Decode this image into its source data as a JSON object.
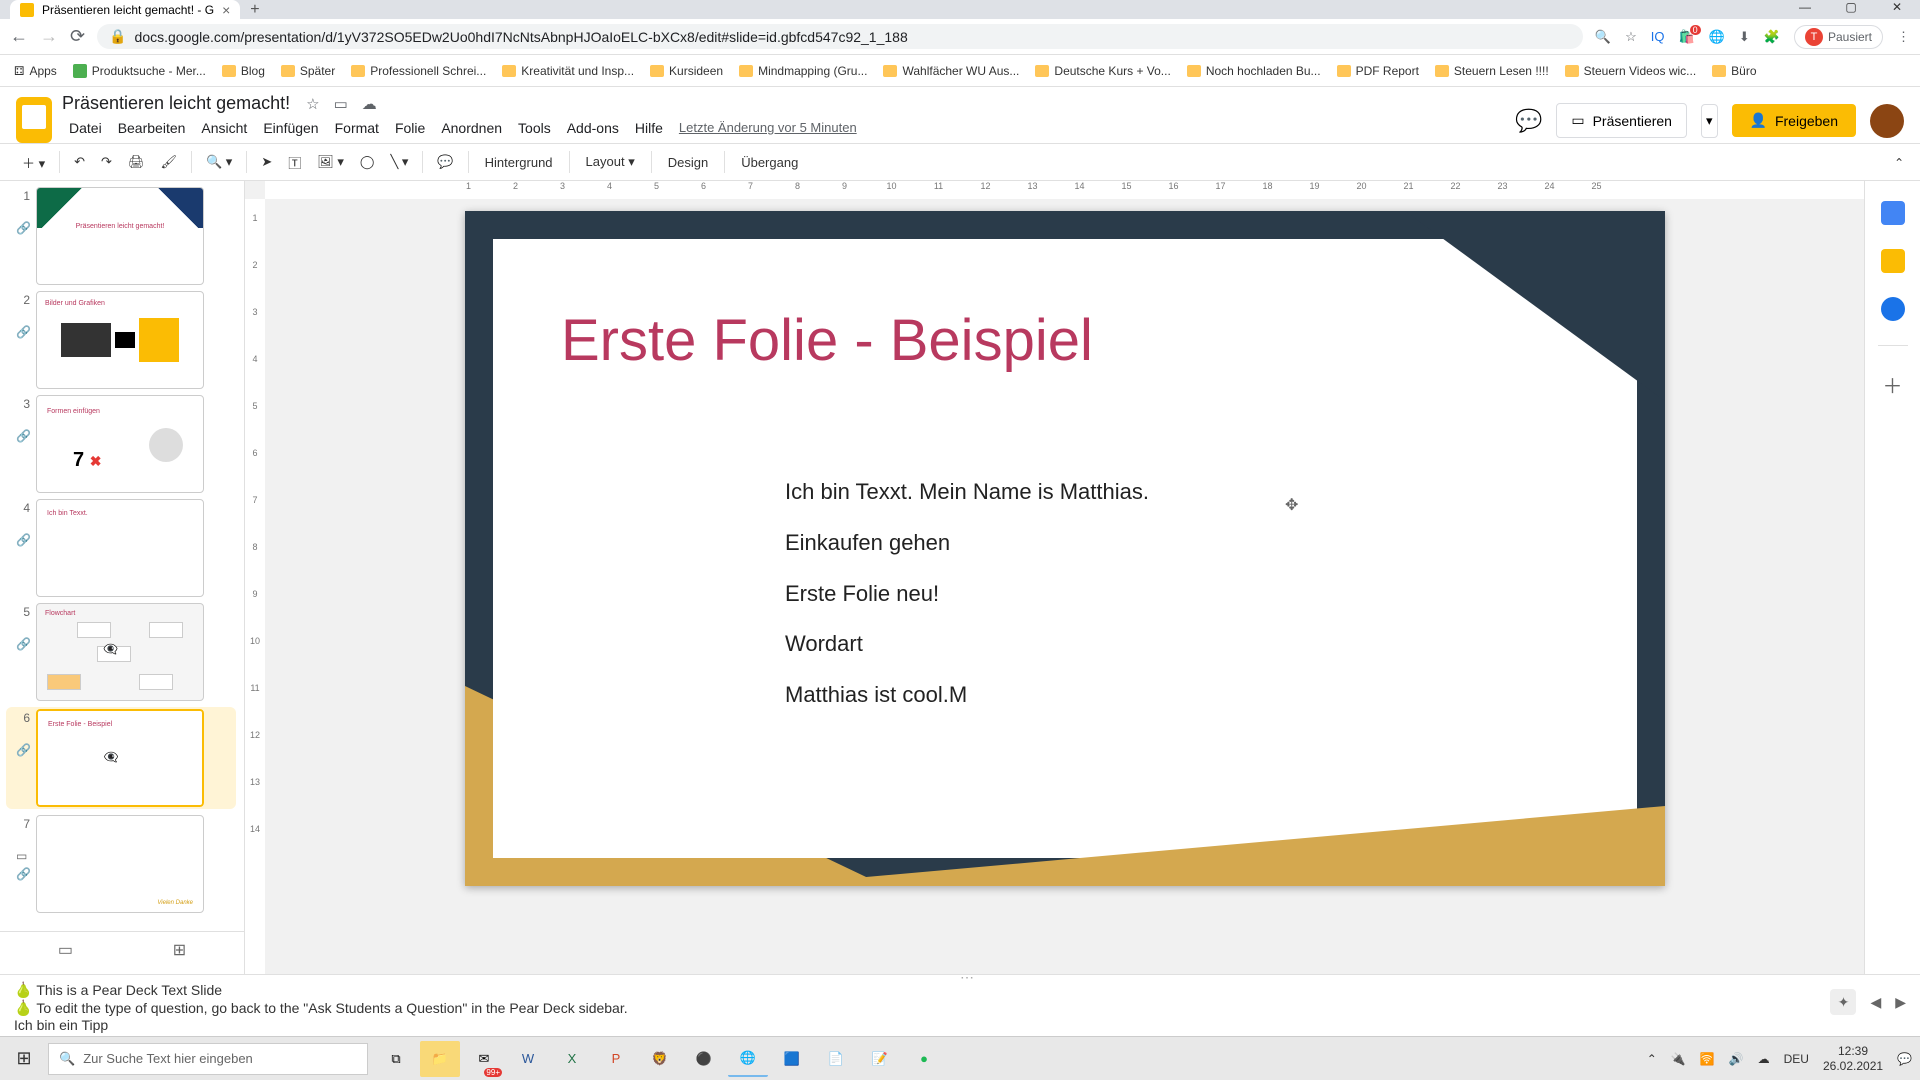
{
  "browser": {
    "tab_title": "Präsentieren leicht gemacht! - G",
    "url": "docs.google.com/presentation/d/1yV372SO5EDw2Uo0hdI7NcNtsAbnpHJOaIoELC-bXCx8/edit#slide=id.gbfcd547c92_1_188",
    "pause_label": "Pausiert"
  },
  "bookmarks": [
    "Apps",
    "Produktsuche - Mer...",
    "Blog",
    "Später",
    "Professionell Schrei...",
    "Kreativität und Insp...",
    "Kursideen",
    "Mindmapping  (Gru...",
    "Wahlfächer WU Aus...",
    "Deutsche Kurs + Vo...",
    "Noch hochladen Bu...",
    "PDF Report",
    "Steuern Lesen !!!!",
    "Steuern Videos wic...",
    "Büro"
  ],
  "doc": {
    "title": "Präsentieren leicht gemacht!",
    "last_edit": "Letzte Änderung vor 5 Minuten"
  },
  "menus": [
    "Datei",
    "Bearbeiten",
    "Ansicht",
    "Einfügen",
    "Format",
    "Folie",
    "Anordnen",
    "Tools",
    "Add-ons",
    "Hilfe"
  ],
  "header_buttons": {
    "present": "Präsentieren",
    "share": "Freigeben"
  },
  "toolbar": {
    "background": "Hintergrund",
    "layout": "Layout",
    "design": "Design",
    "transition": "Übergang"
  },
  "ruler_h": [
    "1",
    "2",
    "3",
    "4",
    "5",
    "6",
    "7",
    "8",
    "9",
    "10",
    "11",
    "12",
    "13",
    "14",
    "15",
    "16",
    "17",
    "18",
    "19",
    "20",
    "21",
    "22",
    "23",
    "24",
    "25"
  ],
  "ruler_v": [
    "1",
    "2",
    "3",
    "4",
    "5",
    "6",
    "7",
    "8",
    "9",
    "10",
    "11",
    "12",
    "13",
    "14"
  ],
  "thumbs": [
    {
      "num": "1",
      "title": "Präsentieren leicht gemacht!"
    },
    {
      "num": "2",
      "title": "Bilder und Grafiken"
    },
    {
      "num": "3",
      "title": "Formen einfügen",
      "seven": "7",
      "x": "✖"
    },
    {
      "num": "4",
      "title": "Ich bin Texxt."
    },
    {
      "num": "5",
      "title": "Flowchart"
    },
    {
      "num": "6",
      "title": "Erste Folie - Beispiel"
    },
    {
      "num": "7",
      "sig": "Vielen Danke"
    }
  ],
  "slide": {
    "title": "Erste Folie - Beispiel",
    "body": [
      "Ich bin Texxt. Mein Name is Matthias.",
      "Einkaufen gehen",
      "Erste Folie neu!",
      "",
      "Wordart",
      "Matthias ist cool.M"
    ]
  },
  "speaker_notes": {
    "line1": "This is a Pear Deck Text Slide",
    "line2": "To edit the type of question, go back to the \"Ask Students a Question\" in the Pear Deck sidebar.",
    "line3": "Ich bin ein Tipp"
  },
  "taskbar": {
    "search_placeholder": "Zur Suche Text hier eingeben",
    "notif_count": "99+",
    "lang": "DEU",
    "time": "12:39",
    "date": "26.02.2021"
  }
}
